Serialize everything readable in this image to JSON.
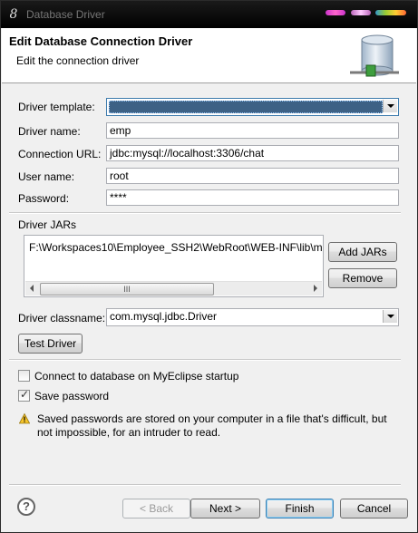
{
  "window": {
    "title": "Database Driver",
    "app_icon_glyph": "8"
  },
  "header": {
    "title": "Edit Database Connection Driver",
    "subtitle": "Edit the connection driver",
    "icon": "database-icon"
  },
  "form": {
    "driver_template_label": "Driver template:",
    "driver_template_value": "",
    "driver_name_label": "Driver name:",
    "driver_name_value": "emp",
    "connection_url_label": "Connection URL:",
    "connection_url_value": "jdbc:mysql://localhost:3306/chat",
    "user_name_label": "User name:",
    "user_name_value": "root",
    "password_label": "Password:",
    "password_value": "****"
  },
  "jars": {
    "label": "Driver JARs",
    "items": [
      "F:\\Workspaces10\\Employee_SSH2\\WebRoot\\WEB-INF\\lib\\m"
    ],
    "scroll_thumb_glyph": "III",
    "add_button": "Add JARs",
    "remove_button": "Remove"
  },
  "classname": {
    "label": "Driver classname:",
    "value": "com.mysql.jdbc.Driver"
  },
  "test_driver_button": "Test Driver",
  "options": {
    "connect_on_startup_label": "Connect to database on MyEclipse startup",
    "connect_on_startup_checked": false,
    "save_password_label": "Save password",
    "save_password_checked": true
  },
  "warning": {
    "icon": "warning-icon",
    "text": "Saved passwords are stored on your computer in a file that's difficult, but not impossible, for an intruder to read."
  },
  "footer": {
    "back_button": "< Back",
    "next_button": "Next >",
    "finish_button": "Finish",
    "cancel_button": "Cancel"
  },
  "colors": {
    "selection": "#3d6185",
    "dialog_bg": "#f0f0f0",
    "default_button_border": "#3c7fb1"
  }
}
